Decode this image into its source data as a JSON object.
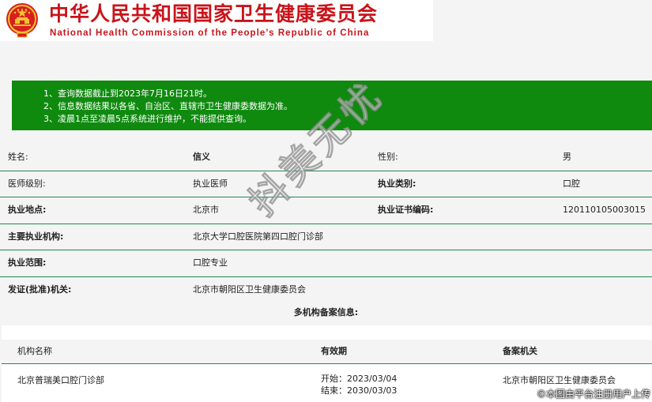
{
  "header": {
    "title": "中华人民共和国国家卫生健康委员会",
    "subtitle": "National Health Commission of the People’s Republic of China",
    "emblem_icon": "national-emblem-icon"
  },
  "notice": {
    "lines": [
      "1、查询数据截止到2023年7月16日21时。",
      "2、信息数据结果以各省、自治区、直辖市卫生健康委数据为准。",
      "3、凌晨1点至凌晨5点系统进行维护，不能提供查询。"
    ]
  },
  "info": {
    "name_label": "姓名:",
    "name_value": "信义",
    "gender_label": "性别:",
    "gender_value": "男",
    "level_label": "医师级别:",
    "level_value": "执业医师",
    "category_label": "执业类别:",
    "category_value": "口腔",
    "location_label": "执业地点:",
    "location_value": "北京市",
    "cert_label": "执业证书编码:",
    "cert_value": "120110105003015",
    "institution_label": "主要执业机构:",
    "institution_value": "北京大学口腔医院第四口腔门诊部",
    "scope_label": "执业范围:",
    "scope_value": "口腔专业",
    "issuer_label": "发证(批准)机关:",
    "issuer_value": "北京市朝阳区卫生健康委员会"
  },
  "multi": {
    "title": "多机构备案信息:",
    "headers": [
      "机构名称",
      "有效期",
      "备案机关"
    ],
    "rows": [
      {
        "name": "北京普瑞美口腔门诊部",
        "start": "开始：2023/03/04",
        "end": "结束：2030/03/03",
        "issuer": "北京市朝阳区卫生健康委员会"
      }
    ]
  },
  "watermark": "抖美无忧",
  "corner_note": "©本图由平台注册用户上传",
  "colors": {
    "brand_red": "#c8141a",
    "notice_green": "#0f8a0f",
    "divider_green": "#1e8a4e"
  }
}
